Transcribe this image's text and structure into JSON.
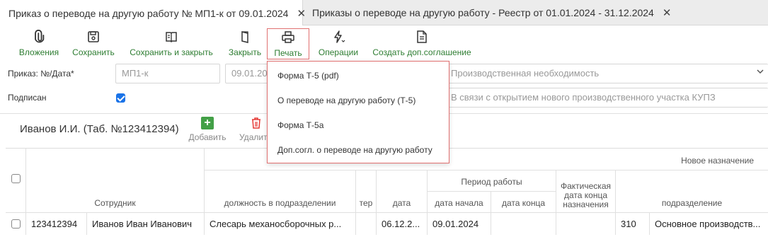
{
  "tabs": [
    {
      "label": "Приказ о переводе на другую работу № МП1-к от 09.01.2024",
      "close": "✕"
    },
    {
      "label": "Приказы о переводе на другую работу - Реестр от 01.01.2024 - 31.12.2024",
      "close": "✕"
    }
  ],
  "toolbar": {
    "attachments": "Вложения",
    "save": "Сохранить",
    "save_close": "Сохранить и закрыть",
    "close": "Закрыть",
    "print": "Печать",
    "operations": "Операции",
    "create_agreement": "Создать доп.соглашение"
  },
  "form": {
    "order_label": "Приказ: №/Дата*",
    "order_number": "МП1-к",
    "order_date": "09.01.2024",
    "signed_label": "Подписан",
    "reason": "Производственная необходимость",
    "basis": "В связи с открытием нового производственного участка КУПЗ"
  },
  "print_menu": [
    "Форма Т-5 (pdf)",
    "О переводе на другую работу (Т-5)",
    "Форма Т-5а",
    "Доп.согл. о переводе на другую работу"
  ],
  "employee": {
    "title": "Иванов И.И. (Таб. №123412394)",
    "add": "Добавить",
    "delete": "Удалить"
  },
  "table": {
    "group_new": "Новое назначение",
    "group_period": "Период работы",
    "headers": {
      "employee": "Сотрудник",
      "position": "должность в подразделении",
      "ter": "тер",
      "date": "дата",
      "start": "дата начала",
      "end": "дата конца",
      "actual_end": "Фактическая дата конца назначения",
      "department": "подразделение"
    },
    "row": {
      "tab_no": "123412394",
      "name": "Иванов Иван Иванович",
      "position": "Слесарь механосборочных р...",
      "ter": "",
      "date": "06.12.2...",
      "start": "09.01.2024",
      "end": "",
      "actual_end": "",
      "dept_code": "310",
      "department": "Основное производств..."
    }
  }
}
